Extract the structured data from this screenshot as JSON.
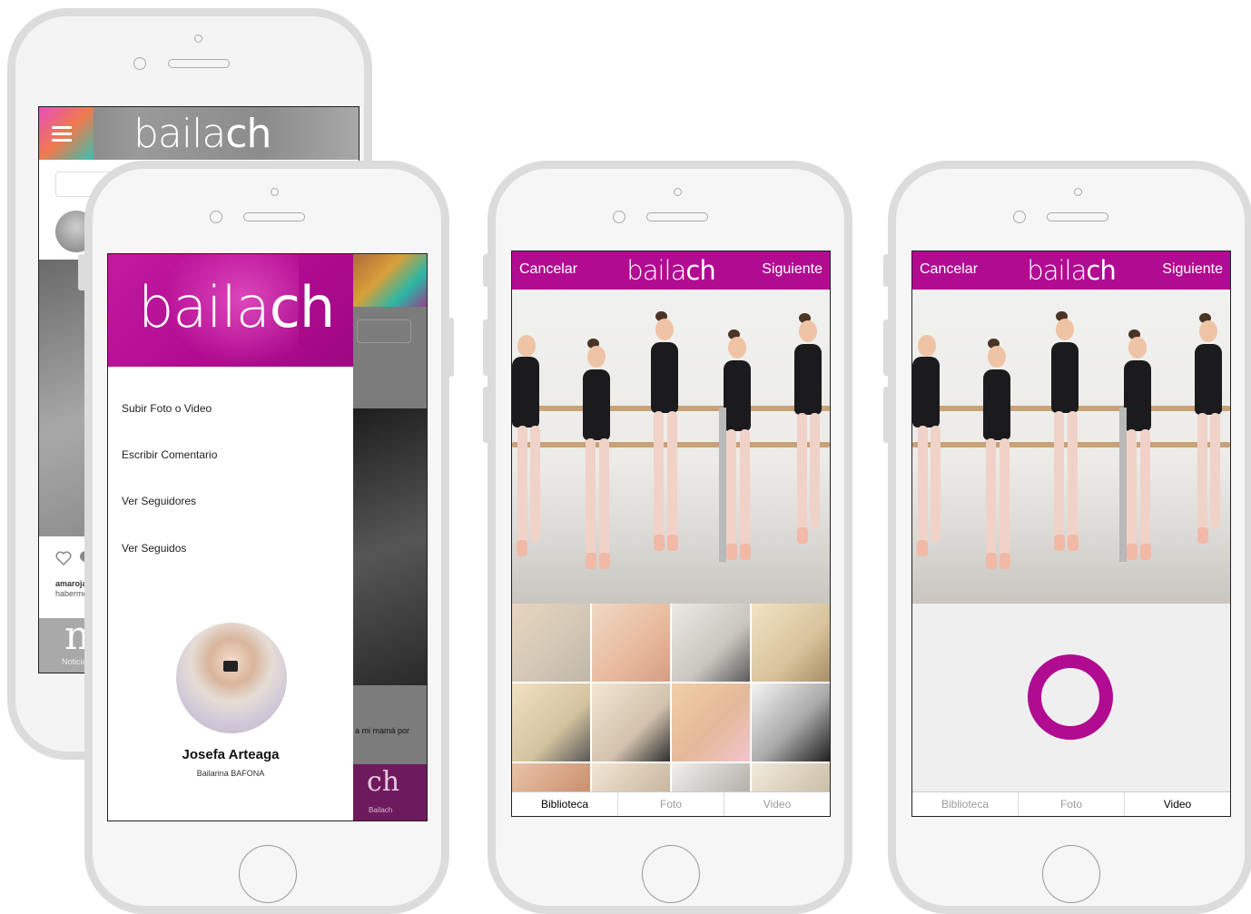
{
  "app": {
    "logo_text": "baila",
    "logo_ch": "ch"
  },
  "colors": {
    "brand": "#b10b92",
    "brand_light": "#e05fcb"
  },
  "feed": {
    "user": "amarojas",
    "caption": "haberme",
    "nav_icon_letter": "n",
    "nav_label": "Noticias"
  },
  "drawer": {
    "menu": [
      "Subir Foto o Video",
      "Escribir Comentario",
      "Ver Seguidores",
      "Ver Seguidos"
    ],
    "profile_name": "Josefa Arteaga",
    "profile_subtitle": "Bailarina BAFONA",
    "behind_caption": "a mi mamá por",
    "behind_logo": "ch",
    "behind_label": "Bailach"
  },
  "upload": {
    "cancel": "Cancelar",
    "next": "Siguiente",
    "tabs": [
      "Biblioteca",
      "Foto",
      "Video"
    ],
    "library_selected": "Biblioteca",
    "video_selected": "Video"
  },
  "icons": [
    "hamburger-icon",
    "heart-icon",
    "comment-icon",
    "record-button-icon"
  ]
}
